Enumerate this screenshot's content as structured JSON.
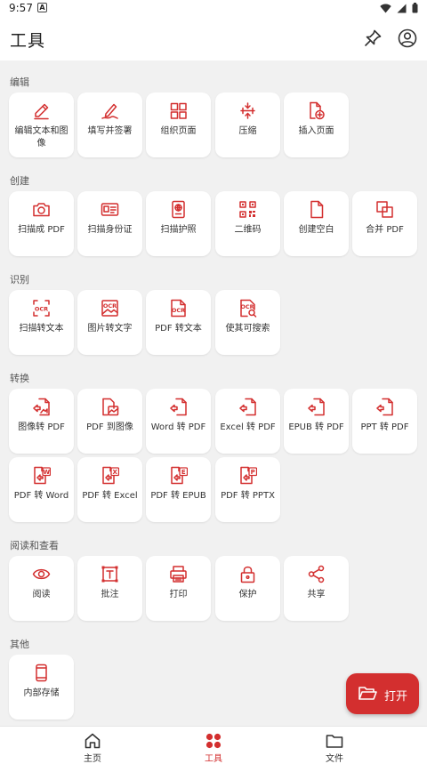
{
  "status_bar": {
    "time": "9:57",
    "notification_badge": "A"
  },
  "header": {
    "title": "工具",
    "pin_icon": "pin-icon",
    "account_icon": "account-icon"
  },
  "colors": {
    "accent": "#d32f2f",
    "background": "#f1f1f1",
    "card": "#ffffff"
  },
  "sections": [
    {
      "label": "编辑",
      "items": [
        {
          "label": "编辑文本和图像",
          "icon": "edit-pencil-icon"
        },
        {
          "label": "填写并签署",
          "icon": "sign-pen-icon"
        },
        {
          "label": "组织页面",
          "icon": "grid-pages-icon"
        },
        {
          "label": "压缩",
          "icon": "compress-icon"
        },
        {
          "label": "插入页面",
          "icon": "insert-page-icon"
        }
      ]
    },
    {
      "label": "创建",
      "items": [
        {
          "label": "扫描成 PDF",
          "icon": "camera-icon"
        },
        {
          "label": "扫描身份证",
          "icon": "id-card-icon"
        },
        {
          "label": "扫描护照",
          "icon": "passport-icon"
        },
        {
          "label": "二维码",
          "icon": "qr-code-icon"
        },
        {
          "label": "创建空白",
          "icon": "blank-page-icon"
        },
        {
          "label": "合并 PDF",
          "icon": "merge-icon"
        }
      ]
    },
    {
      "label": "识别",
      "items": [
        {
          "label": "扫描转文本",
          "icon": "ocr-scan-icon"
        },
        {
          "label": "图片转文字",
          "icon": "ocr-image-icon"
        },
        {
          "label": "PDF 转文本",
          "icon": "ocr-pdf-icon"
        },
        {
          "label": "使其可搜索",
          "icon": "ocr-search-icon"
        }
      ]
    },
    {
      "label": "转换",
      "items": [
        {
          "label": "图像转 PDF",
          "icon": "convert-image-icon"
        },
        {
          "label": "PDF 到图像",
          "icon": "convert-to-image-icon"
        },
        {
          "label": "Word 转 PDF",
          "icon": "convert-word-icon"
        },
        {
          "label": "Excel 转 PDF",
          "icon": "convert-excel-icon"
        },
        {
          "label": "EPUB 转 PDF",
          "icon": "convert-epub-icon"
        },
        {
          "label": "PPT 转 PDF",
          "icon": "convert-ppt-icon"
        },
        {
          "label": "PDF 转 Word",
          "icon": "to-word-icon",
          "badge": "W"
        },
        {
          "label": "PDF 转 Excel",
          "icon": "to-excel-icon",
          "badge": "X"
        },
        {
          "label": "PDF 转 EPUB",
          "icon": "to-epub-icon",
          "badge": "E"
        },
        {
          "label": "PDF 转 PPTX",
          "icon": "to-pptx-icon",
          "badge": "P"
        }
      ]
    },
    {
      "label": "阅读和查看",
      "items": [
        {
          "label": "阅读",
          "icon": "eye-icon"
        },
        {
          "label": "批注",
          "icon": "text-box-icon"
        },
        {
          "label": "打印",
          "icon": "printer-icon"
        },
        {
          "label": "保护",
          "icon": "lock-icon"
        },
        {
          "label": "共享",
          "icon": "share-icon"
        }
      ]
    },
    {
      "label": "其他",
      "items": [
        {
          "label": "内部存储",
          "icon": "phone-icon"
        }
      ]
    }
  ],
  "fab": {
    "label": "打开",
    "icon": "folder-open-icon"
  },
  "bottom_nav": [
    {
      "label": "主页",
      "icon": "home-icon"
    },
    {
      "label": "工具",
      "icon": "tools-icon",
      "active": true
    },
    {
      "label": "文件",
      "icon": "folder-icon"
    }
  ]
}
